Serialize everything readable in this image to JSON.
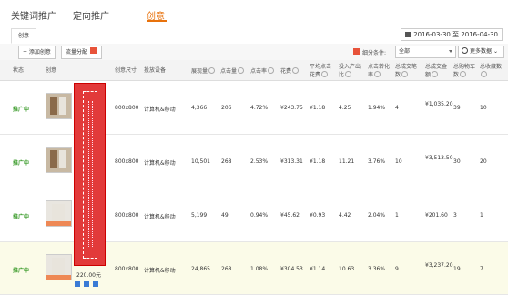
{
  "nav": {
    "tabs": [
      "关键词推广",
      "定向推广",
      "创意"
    ],
    "active": "创意"
  },
  "subtab": "创意",
  "date_range": "2016-03-30 至 2016-04-30",
  "toolbar": {
    "add_label": "+ 添加创意",
    "flow_label": "流量分配",
    "flow_badge": "",
    "filter_label": "细分条件:",
    "filter_value": "全部",
    "more_label": "更多数据"
  },
  "columns": [
    "状态",
    "创意",
    "创意尺寸",
    "投放设备",
    "展现量",
    "点击量",
    "点击率",
    "花费",
    "平均点击花费",
    "投入产出比",
    "点击转化率",
    "总成交笔数",
    "总成交金额",
    "总购物车数",
    "总收藏数"
  ],
  "rows": [
    {
      "status": "推广中",
      "size": "800x800",
      "device": "计算机&移动",
      "impressions": "4,366",
      "clicks": "206",
      "ctr": "4.72%",
      "cost": "¥243.75",
      "cpc": "¥1.18",
      "roi": "4.25",
      "cvr": "1.94%",
      "orders": "4",
      "gmv": "¥1,035.20",
      "carts": "39",
      "favs": "10"
    },
    {
      "status": "推广中",
      "size": "800x800",
      "device": "计算机&移动",
      "impressions": "10,501",
      "clicks": "268",
      "ctr": "2.53%",
      "cost": "¥313.31",
      "cpc": "¥1.18",
      "roi": "11.21",
      "cvr": "3.76%",
      "orders": "10",
      "gmv": "¥3,513.50",
      "carts": "30",
      "favs": "20"
    },
    {
      "status": "推广中",
      "size": "800x800",
      "device": "计算机&移动",
      "impressions": "5,199",
      "clicks": "49",
      "ctr": "0.94%",
      "cost": "¥45.62",
      "cpc": "¥0.93",
      "roi": "4.42",
      "cvr": "2.04%",
      "orders": "1",
      "gmv": "¥201.60",
      "carts": "3",
      "favs": "1"
    },
    {
      "status": "推广中",
      "size": "800x800",
      "device": "计算机&移动",
      "impressions": "24,865",
      "clicks": "268",
      "ctr": "1.08%",
      "cost": "¥304.53",
      "cpc": "¥1.14",
      "roi": "10.63",
      "cvr": "3.36%",
      "orders": "9",
      "gmv": "¥3,237.20",
      "carts": "19",
      "favs": "7"
    }
  ],
  "price": "220.00元"
}
